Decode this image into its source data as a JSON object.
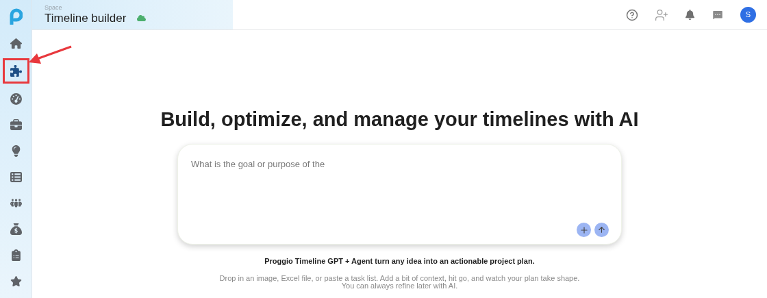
{
  "header": {
    "breadcrumb": "Space",
    "title": "Timeline builder",
    "avatar_initial": "S"
  },
  "sidebar": {
    "items": [
      {
        "kind": "home",
        "selected": false,
        "highlighted": false
      },
      {
        "kind": "puzzle",
        "selected": true,
        "highlighted": true
      },
      {
        "kind": "gauge",
        "selected": false,
        "highlighted": false
      },
      {
        "kind": "briefcase",
        "selected": false,
        "highlighted": false
      },
      {
        "kind": "lightbulb",
        "selected": false,
        "highlighted": false
      },
      {
        "kind": "list",
        "selected": false,
        "highlighted": false
      },
      {
        "kind": "people",
        "selected": false,
        "highlighted": false
      },
      {
        "kind": "money",
        "selected": false,
        "highlighted": false
      },
      {
        "kind": "clipboard",
        "selected": false,
        "highlighted": false
      },
      {
        "kind": "star",
        "selected": false,
        "highlighted": false
      }
    ]
  },
  "main": {
    "heading": "Build, optimize, and manage your timelines with AI",
    "prompt": {
      "placeholder": "What is the goal or purpose of the"
    },
    "tagline": "Proggio Timeline GPT + Agent turn any idea into an actionable project plan.",
    "hint_lines": [
      "Drop in an image, Excel file, or paste a task list. Add a bit of context, hit go, and watch your plan take shape.",
      "You can always refine later with AI."
    ]
  }
}
